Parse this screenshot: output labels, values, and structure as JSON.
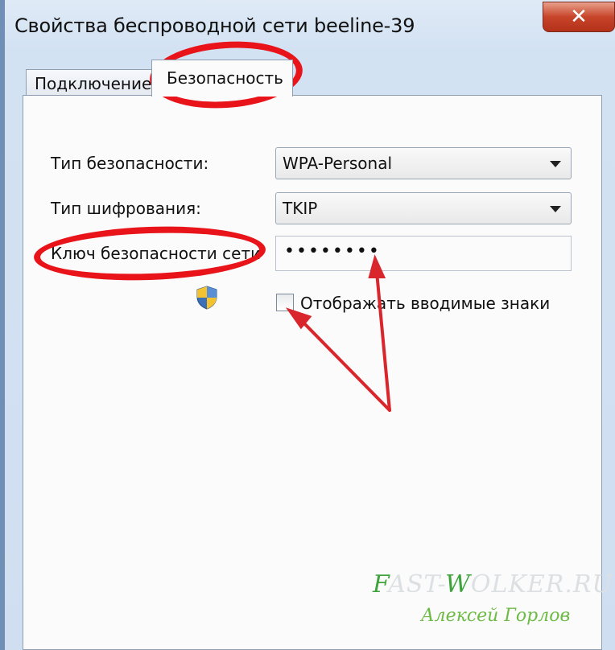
{
  "window": {
    "title": "Свойства беспроводной сети beeline-39",
    "close_symbol": "✕"
  },
  "tabs": [
    {
      "label": "Подключение",
      "selected": false
    },
    {
      "label": "Безопасность",
      "selected": true
    }
  ],
  "security": {
    "type_label": "Тип безопасности:",
    "type_value": "WPA-Personal",
    "encryption_label": "Тип шифрования:",
    "encryption_value": "TKIP",
    "key_label": "Ключ безопасности сети",
    "key_value": "••••••••",
    "show_chars_label": "Отображать вводимые знаки",
    "show_chars_checked": false
  },
  "icons": {
    "shield": "uac-shield-icon",
    "dropdown": "chevron-down-icon",
    "close": "close-icon"
  },
  "annotations": {
    "highlight_color": "#e8141a"
  },
  "watermark": {
    "site_prefix": "F",
    "site_part1": "AST-",
    "site_w": "W",
    "site_part2": "OLKER.RU",
    "author": "Алексей Горлов"
  }
}
